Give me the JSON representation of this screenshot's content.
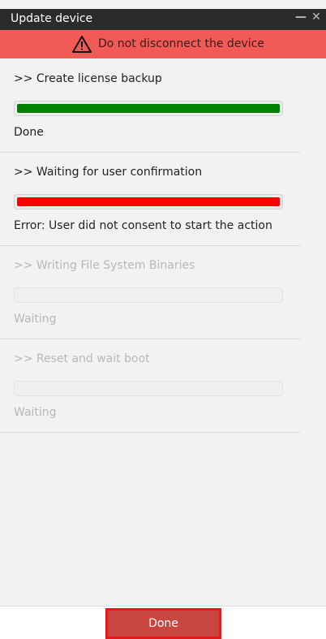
{
  "window": {
    "title": "Update device"
  },
  "warning": {
    "message": "Do not disconnect the device",
    "icon": "warning-icon"
  },
  "steps": [
    {
      "label": ">> Create license backup",
      "status": "Done",
      "progress": 1.0,
      "color": "#008000",
      "state": "done"
    },
    {
      "label": ">> Waiting for user confirmation",
      "status": "Error: User did not consent to start the action",
      "progress": 1.0,
      "color": "#ff0000",
      "state": "error"
    },
    {
      "label": ">> Writing File System Binaries",
      "status": "Waiting",
      "progress": 0,
      "color": "",
      "state": "waiting"
    },
    {
      "label": ">> Reset and wait boot",
      "status": "Waiting",
      "progress": 0,
      "color": "",
      "state": "waiting"
    }
  ],
  "footer": {
    "done_label": "Done"
  },
  "colors": {
    "titlebar": "#2b2b2b",
    "warning_bg": "#f25a56",
    "button": "#c9453f",
    "button_border": "#e01b1b"
  }
}
